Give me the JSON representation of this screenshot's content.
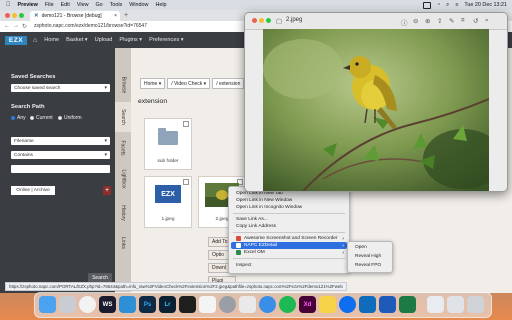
{
  "menubar": {
    "app_name": "Preview",
    "items": [
      "File",
      "Edit",
      "View",
      "Go",
      "Tools",
      "Window",
      "Help"
    ],
    "clock": "Tue 20 Dec  13:21"
  },
  "browser": {
    "tab_title": "demo121 - Browse [debug]",
    "tab_close": "×",
    "new_tab": "+",
    "url": "zsphoto.napc.com/ezx/demo121/browse?id=76547"
  },
  "appnav": {
    "logo": "EZX",
    "items": [
      "Home",
      "Basket ▾",
      "Upload",
      "Plugins ▾",
      "Preferences ▾"
    ]
  },
  "sidebar": {
    "saved_searches_heading": "Saved Searches",
    "saved_search_select": "Choose saved search",
    "search_path_heading": "Search Path",
    "radios": [
      {
        "label": "Any",
        "checked": true
      },
      {
        "label": "Current",
        "checked": false
      },
      {
        "label": "Uniform",
        "checked": false
      }
    ],
    "field_select": "Filename",
    "operator_select": "Contains",
    "search_value": "",
    "archive_button": "Online | Archive",
    "add_button": "+",
    "search_button": "Search"
  },
  "vtabs": [
    "Browse",
    "Search",
    "Facets",
    "Lightbox",
    "History",
    "Links"
  ],
  "main": {
    "breadcrumb": [
      "Home ▾",
      "/ Video Check ▾",
      "/ extension"
    ],
    "folder_title": "extension",
    "tiles": [
      {
        "label": "sub folder"
      },
      {
        "label": "1.jpeg"
      },
      {
        "label": "2.jpeg"
      }
    ],
    "option_buttons": [
      "Add To",
      "Optio",
      "Downl",
      "Plugi"
    ]
  },
  "status_url": "https://zsphoto.napc.com/PORTAL/EZX.php?id=76544&path=info_raw%2FVideoCheck%2Fextension%2F2.jpeg&pathfile=zsphoto.napc.com%2Fezx%2Fdemo121%2Fweb",
  "context_menu": {
    "items": [
      {
        "label": "Open Link in New Tab"
      },
      {
        "label": "Open Link in New Window"
      },
      {
        "label": "Open Link in Incognito Window"
      },
      {
        "sep": true
      },
      {
        "label": "Save Link As..."
      },
      {
        "label": "Copy Link Address"
      },
      {
        "sep": true
      },
      {
        "label": "Awesome Screenshot and Screen Recorder",
        "arrow": true,
        "icon": "camera"
      },
      {
        "label": "NAPC EZDetail",
        "arrow": true,
        "icon": "napc",
        "highlight": true
      },
      {
        "label": "Excel OM",
        "arrow": true,
        "icon": "excel"
      },
      {
        "sep": true
      },
      {
        "label": "Inspect"
      }
    ],
    "submenu": [
      "Open",
      "Reveal High",
      "Reveal FPO"
    ]
  },
  "preview": {
    "title": "2.jpeg"
  },
  "colors": {
    "accent": "#2f6fe0",
    "app_nav": "#3b3f44",
    "sidebar": "#3a3d41",
    "logo": "#2e86c1",
    "add_button": "#8a2d2b"
  },
  "dock": {
    "apps": [
      "finder-icon",
      "launchpad-icon",
      "chrome-icon",
      "webstorm-icon",
      "vscode-icon",
      "photoshop-icon",
      "lightroom-icon",
      "terminal-icon",
      "slack-icon",
      "settings-icon",
      "preview-icon",
      "safari-icon",
      "spotify-icon",
      "xd-icon",
      "notes-icon",
      "teamviewer-icon",
      "outlook-icon",
      "word-icon",
      "excel-icon",
      "folder-icon",
      "downloads-icon",
      "trash-icon"
    ]
  }
}
